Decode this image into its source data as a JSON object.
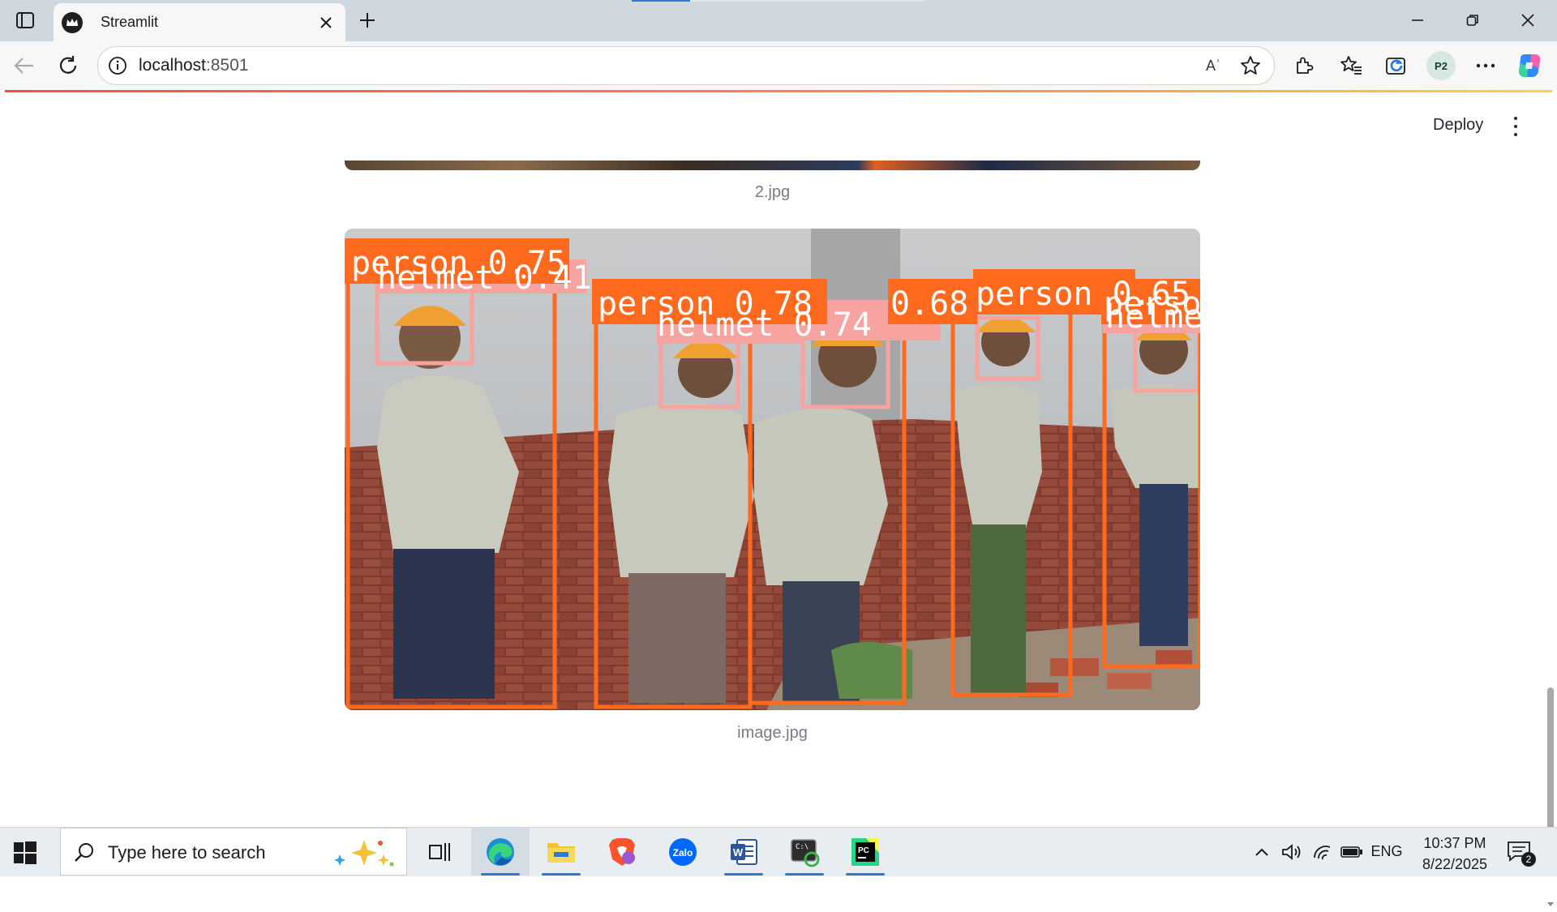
{
  "browser": {
    "tab_title": "Streamlit",
    "url_host": "localhost",
    "url_port": ":8501",
    "read_aloud_label": "Aʾ"
  },
  "app": {
    "deploy_label": "Deploy",
    "images": [
      {
        "caption": "2.jpg"
      },
      {
        "caption": "image.jpg"
      }
    ],
    "detections": [
      {
        "label": "person 0.75",
        "class": "person"
      },
      {
        "label": "helmet 0.41",
        "class": "helmet"
      },
      {
        "label": "person 0.78",
        "class": "person"
      },
      {
        "label": "helmet 0.74",
        "class": "helmet"
      },
      {
        "label": "0.68",
        "class": "person"
      },
      {
        "label": "person 0.65",
        "class": "person"
      },
      {
        "label": "helmet",
        "class": "helmet"
      },
      {
        "label": "perso",
        "class": "person"
      }
    ],
    "colors": {
      "person_box": "#ff6a1f",
      "helmet_box": "#f7a3a0"
    }
  },
  "taskbar": {
    "search_placeholder": "Type here to search",
    "language": "ENG",
    "time": "10:37 PM",
    "date": "8/22/2025",
    "notification_count": "2"
  }
}
